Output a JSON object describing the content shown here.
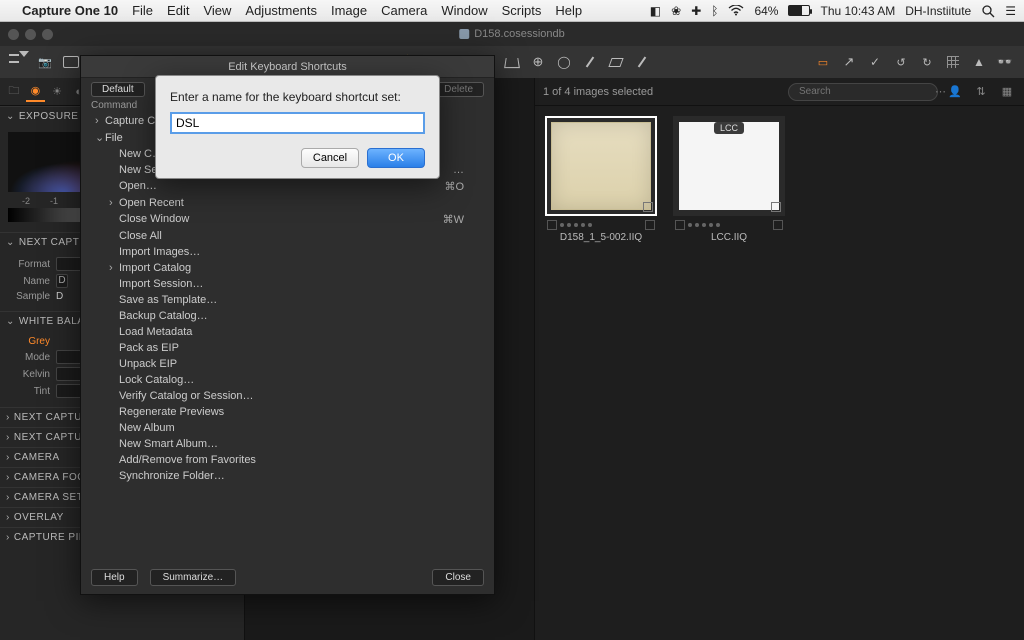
{
  "menubar": {
    "app": "Capture One 10",
    "items": [
      "File",
      "Edit",
      "View",
      "Adjustments",
      "Image",
      "Camera",
      "Window",
      "Scripts",
      "Help"
    ],
    "battery_pct": "64%",
    "clock": "Thu 10:43 AM",
    "user": "DH-Instiitute"
  },
  "titlerow": {
    "doc": "D158.cosessiondb"
  },
  "left": {
    "sections": {
      "exposure": "EXPOSURE EV…",
      "nextcapture": "NEXT CAPTUR…",
      "whitebalance": "WHITE BALAN…"
    },
    "exp_ticks": [
      "-2",
      "-1"
    ],
    "nc": {
      "format_lbl": "Format",
      "name_lbl": "Name",
      "name_val": "D",
      "sample_lbl": "Sample",
      "sample_val": "D"
    },
    "wb": {
      "grey": "Grey",
      "mode": "Mode",
      "kelvin": "Kelvin",
      "tint": "Tint"
    },
    "collapsed": [
      "NEXT CAPTURE…",
      "NEXT CAPTURE…",
      "CAMERA",
      "CAMERA FOCU…",
      "CAMERA SETT…",
      "OVERLAY",
      "CAPTURE PILO…"
    ]
  },
  "browser": {
    "status": "1 of 4 images selected",
    "search_placeholder": "Search",
    "thumbs": [
      {
        "file": "D158_1_5-002.IIQ",
        "selected": true,
        "badge": null,
        "kind": "paper"
      },
      {
        "file": "LCC.IIQ",
        "selected": false,
        "badge": "LCC",
        "kind": "white"
      }
    ]
  },
  "kbmodal": {
    "title": "Edit Keyboard Shortcuts",
    "default": "Default",
    "delete": "Delete",
    "col_cmd": "Command",
    "nodes": {
      "capture": "Capture C…",
      "file": "File",
      "open_recent": "Open Recent",
      "import_catalog": "Import Catalog"
    },
    "leaves": [
      {
        "label": "New C…",
        "sc": ""
      },
      {
        "label": "New Se……",
        "sc": "…"
      },
      {
        "label": "Open…",
        "sc": "⌘O"
      },
      {
        "label": "__node__open_recent"
      },
      {
        "label": "Close Window",
        "sc": "⌘W"
      },
      {
        "label": "Close All",
        "sc": ""
      },
      {
        "label": "Import Images…",
        "sc": ""
      },
      {
        "label": "__node__import_catalog"
      },
      {
        "label": "Import Session…",
        "sc": ""
      },
      {
        "label": "Save as Template…",
        "sc": ""
      },
      {
        "label": "Backup Catalog…",
        "sc": ""
      },
      {
        "label": "Load Metadata",
        "sc": ""
      },
      {
        "label": "Pack as EIP",
        "sc": ""
      },
      {
        "label": "Unpack EIP",
        "sc": ""
      },
      {
        "label": "Lock Catalog…",
        "sc": ""
      },
      {
        "label": "Verify Catalog or Session…",
        "sc": ""
      },
      {
        "label": "Regenerate Previews",
        "sc": ""
      },
      {
        "label": "New Album",
        "sc": ""
      },
      {
        "label": "New Smart Album…",
        "sc": ""
      },
      {
        "label": "Add/Remove from Favorites",
        "sc": ""
      },
      {
        "label": "Synchronize Folder…",
        "sc": ""
      }
    ],
    "help": "Help",
    "summarize": "Summarize…",
    "close": "Close"
  },
  "namedlg": {
    "prompt": "Enter a name for the keyboard shortcut set:",
    "value": "DSL",
    "cancel": "Cancel",
    "ok": "OK"
  }
}
